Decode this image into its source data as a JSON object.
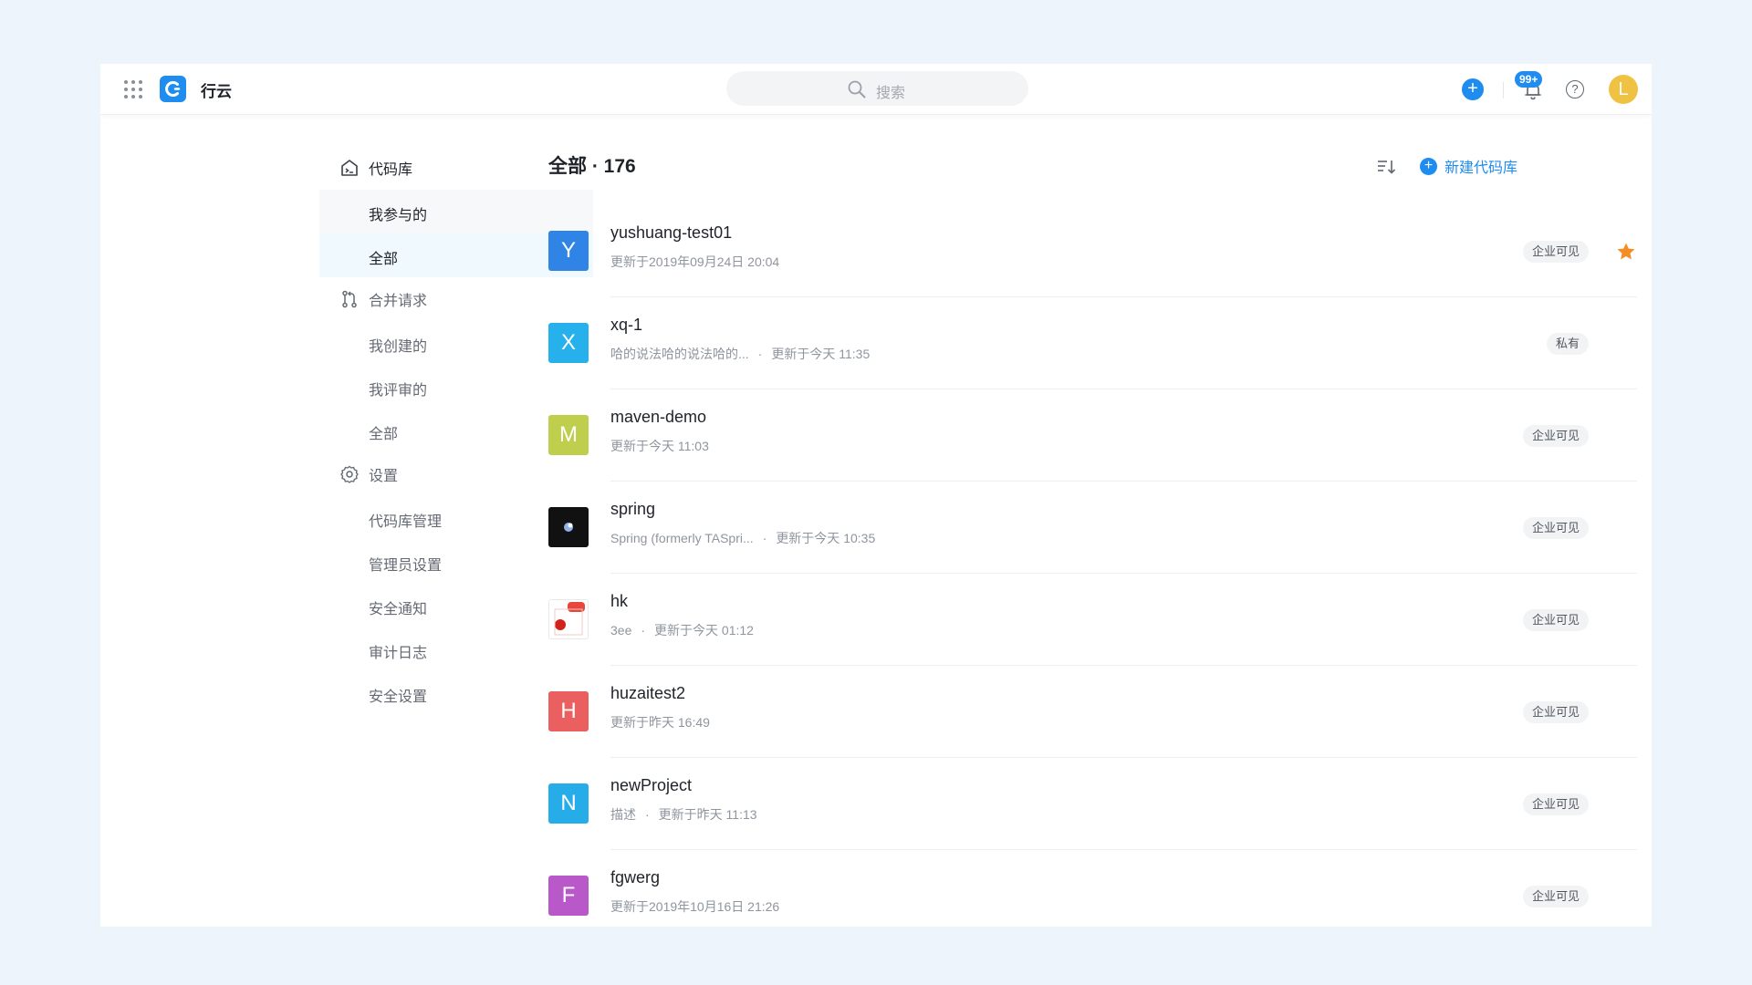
{
  "app": {
    "title": "行云",
    "search_placeholder": "搜索",
    "notification_badge": "99+",
    "avatar_letter": "L",
    "help_symbol": "?",
    "accent_color": "#1f8cf0"
  },
  "sidebar": {
    "groups": [
      {
        "label": "代码库",
        "icon": "repository-icon",
        "items": [
          {
            "label": "我参与的",
            "state": "hover"
          },
          {
            "label": "全部",
            "state": "active"
          }
        ]
      },
      {
        "label": "合并请求",
        "icon": "merge-request-icon",
        "items": [
          {
            "label": "我创建的"
          },
          {
            "label": "我评审的"
          },
          {
            "label": "全部"
          }
        ]
      },
      {
        "label": "设置",
        "icon": "gear-icon",
        "items": [
          {
            "label": "代码库管理"
          },
          {
            "label": "管理员设置"
          },
          {
            "label": "安全通知"
          },
          {
            "label": "审计日志"
          },
          {
            "label": "安全设置"
          }
        ]
      }
    ]
  },
  "main": {
    "title": "全部 · 176",
    "new_repo_label": "新建代码库",
    "repos": [
      {
        "letter": "Y",
        "color": "#2f84e6",
        "name": "yushuang-test01",
        "desc": "",
        "updated": "更新于2019年09月24日 20:04",
        "visibility": "企业可见",
        "starred": true
      },
      {
        "letter": "X",
        "color": "#26b0ec",
        "name": "xq-1",
        "desc": "哈的说法哈的说法哈的...",
        "updated": "更新于今天 11:35",
        "visibility": "私有",
        "starred": false
      },
      {
        "letter": "M",
        "color": "#bfcf4d",
        "name": "maven-demo",
        "desc": "",
        "updated": "更新于今天 11:03",
        "visibility": "企业可见",
        "starred": false
      },
      {
        "letter": "",
        "color": "#111111",
        "image": "spring-logo-image",
        "name": "spring",
        "desc": "Spring (formerly TASpri...",
        "updated": "更新于今天 10:35",
        "visibility": "企业可见",
        "starred": false
      },
      {
        "letter": "",
        "color": "#ffffff",
        "image": "hk-logo-image",
        "name": "hk",
        "desc": "3ee",
        "updated": "更新于今天 01:12",
        "visibility": "企业可见",
        "starred": false
      },
      {
        "letter": "H",
        "color": "#ea5f5f",
        "name": "huzaitest2",
        "desc": "",
        "updated": "更新于昨天 16:49",
        "visibility": "企业可见",
        "starred": false
      },
      {
        "letter": "N",
        "color": "#26ace8",
        "name": "newProject",
        "desc": "描述",
        "updated": "更新于昨天 11:13",
        "visibility": "企业可见",
        "starred": false
      },
      {
        "letter": "F",
        "color": "#b858c9",
        "name": "fgwerg",
        "desc": "",
        "updated": "更新于2019年10月16日 21:26",
        "visibility": "企业可见",
        "starred": false
      }
    ]
  }
}
